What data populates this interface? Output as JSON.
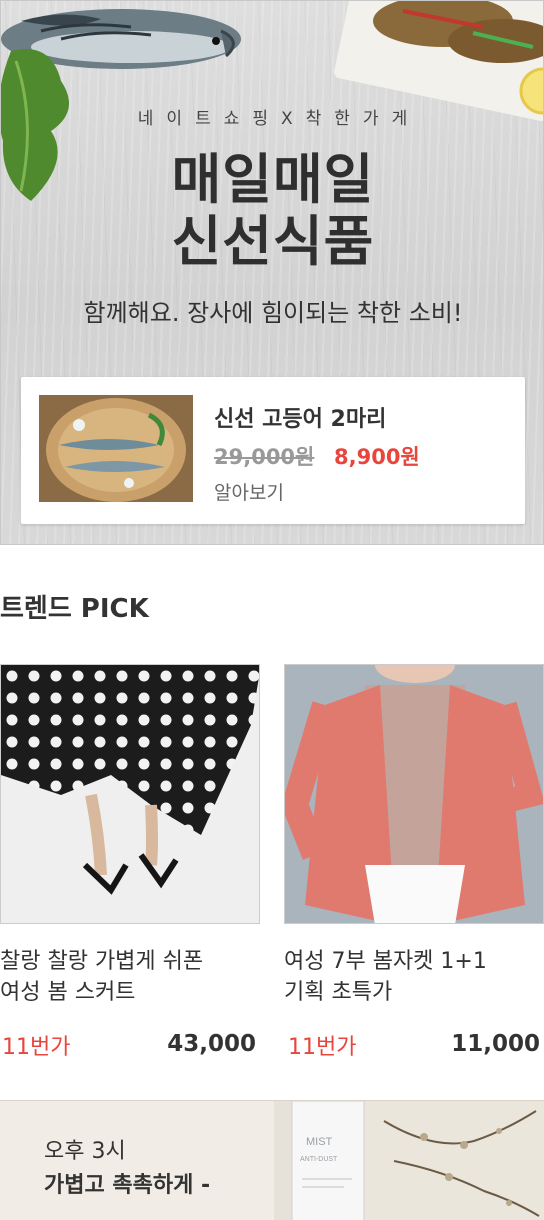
{
  "hero": {
    "kicker": "네이트쇼핑X착한가게",
    "title_line1": "매일매일",
    "title_line2": "신선식품",
    "subtitle": "함께해요. 장사에 힘이되는 착한 소비!",
    "deal": {
      "name": "신선 고등어 2마리",
      "original_price": "29,000원",
      "sale_price": "8,900원",
      "more_link": "알아보기"
    }
  },
  "trend": {
    "title": "트렌드 PICK",
    "products": [
      {
        "name_line1": "찰랑 찰랑 가볍게 쉬폰",
        "name_line2": "여성 봄 스커트",
        "store": "11번가",
        "price": "43,000"
      },
      {
        "name_line1": "여성 7부 봄자켓 1+1",
        "name_line2": "기획 초특가",
        "store": "11번가",
        "price": "11,000"
      }
    ]
  },
  "banner": {
    "time": "오후 3시",
    "copy": "가볍고 촉촉하게 -",
    "product_label_line1": "MIST",
    "product_label_line2": "ANTI-DUST"
  },
  "colors": {
    "accent_red": "#e8453c",
    "text_dark": "#333333",
    "text_muted": "#999999"
  }
}
